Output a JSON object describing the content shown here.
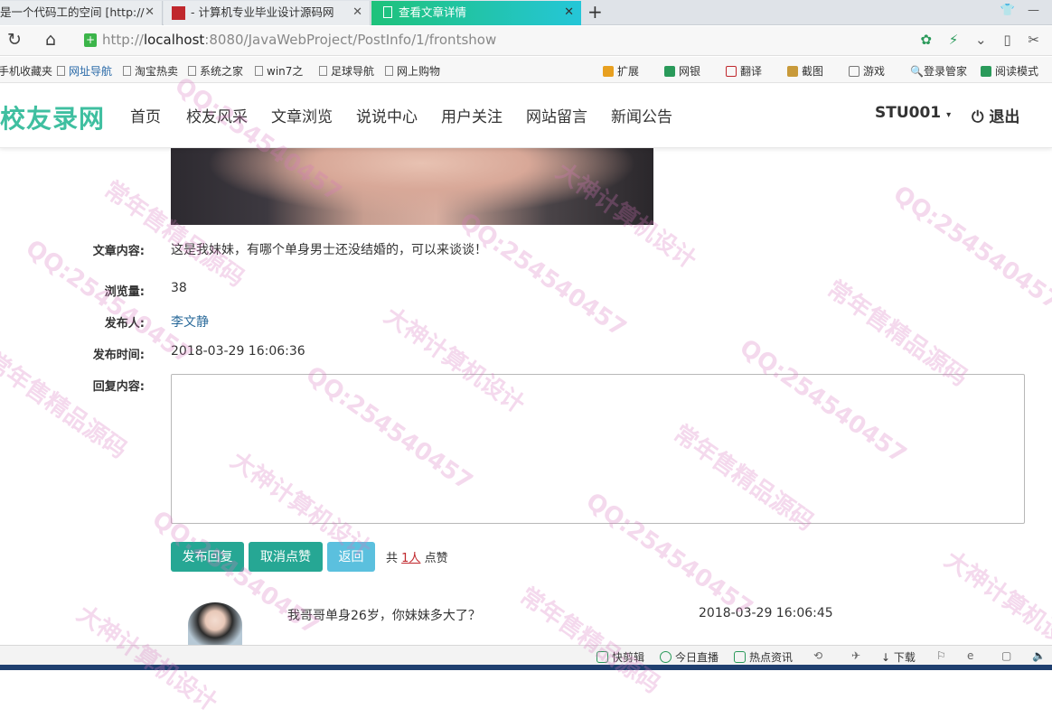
{
  "browser": {
    "tabs": [
      {
        "title": "是一个代码工的空间 [http://",
        "active": false
      },
      {
        "title": "- 计算机专业毕业设计源码网",
        "active": false
      },
      {
        "title": "查看文章详情",
        "active": true
      }
    ],
    "new_tab": "+",
    "url_host": "localhost",
    "url_rest": ":8080/JavaWebProject/PostInfo/1/frontshow",
    "bookmarks": [
      "手机收藏夹",
      "网址导航",
      "淘宝热卖",
      "系统之家",
      "win7之",
      "足球导航",
      "网上购物"
    ],
    "extensions": [
      "扩展",
      "网银",
      "翻译",
      "截图",
      "游戏",
      "登录管家",
      "阅读模式"
    ]
  },
  "site": {
    "brand": "校友录网",
    "nav": [
      "首页",
      "校友风采",
      "文章浏览",
      "说说中心",
      "用户关注",
      "网站留言",
      "新闻公告"
    ],
    "user": "STU001",
    "logout": "退出"
  },
  "post": {
    "content_label": "文章内容:",
    "content": "这是我妹妹，有哪个单身男士还没结婚的，可以来谈谈！",
    "views_label": "浏览量:",
    "views": "38",
    "author_label": "发布人:",
    "author": "李文静",
    "time_label": "发布时间:",
    "time": "2018-03-29 16:06:36",
    "reply_label": "回复内容:"
  },
  "actions": {
    "reply": "发布回复",
    "unlike": "取消点赞",
    "back": "返回",
    "likes_prefix": "共",
    "likes_count": "1人",
    "likes_suffix": "点赞"
  },
  "comments": [
    {
      "text": "我哥哥单身26岁，你妹妹多大了？",
      "time": "2018-03-29 16:06:45"
    }
  ],
  "statusbar": [
    "快剪辑",
    "今日直播",
    "热点资讯",
    "下载"
  ],
  "watermark": [
    "QQ:254540457",
    "常年售精品源码",
    "大神计算机设计"
  ]
}
